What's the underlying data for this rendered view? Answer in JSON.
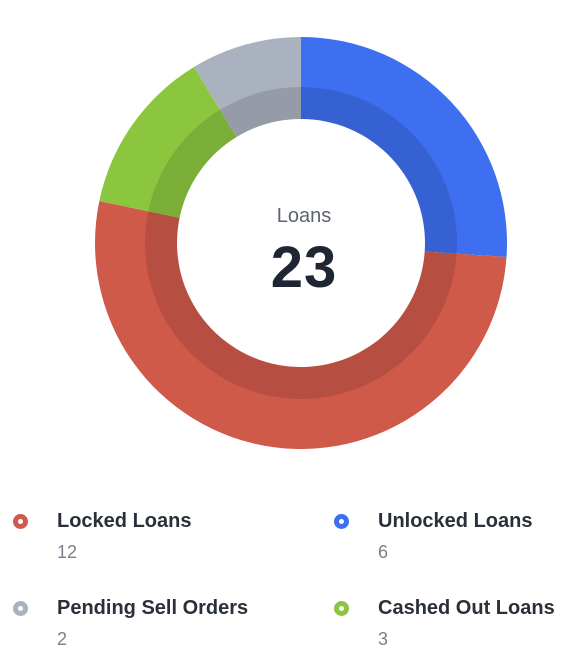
{
  "chart_data": {
    "type": "pie",
    "center_label": "Loans",
    "center_value": "23",
    "categories": [
      "Locked Loans",
      "Unlocked Loans",
      "Pending Sell Orders",
      "Cashed Out Loans"
    ],
    "values": [
      12,
      6,
      2,
      3
    ],
    "colors": [
      "#d05a4a",
      "#3d6ff0",
      "#aab2bf",
      "#8cc63f"
    ],
    "legend_placement": "bottom"
  },
  "legend": [
    {
      "label": "Locked Loans",
      "count": "12",
      "color": "#d05a4a"
    },
    {
      "label": "Unlocked Loans",
      "count": "6",
      "color": "#3d6ff0"
    },
    {
      "label": "Pending Sell Orders",
      "count": "2",
      "color": "#aab2bf"
    },
    {
      "label": "Cashed Out Loans",
      "count": "3",
      "color": "#8cc63f"
    }
  ]
}
